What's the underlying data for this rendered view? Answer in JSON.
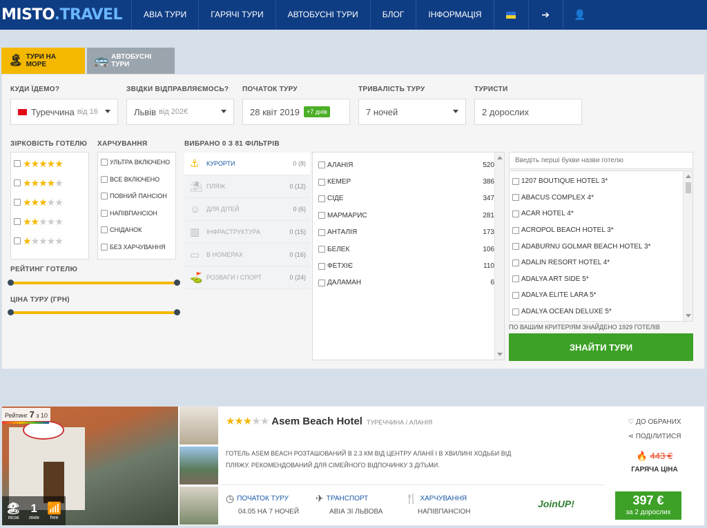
{
  "header": {
    "logo_main": "MISTO",
    "logo_dot": ".",
    "logo_travel": "TRAVEL",
    "nav": [
      "АВІА ТУРИ",
      "ГАРЯЧІ ТУРИ",
      "АВТОБУСНІ ТУРИ",
      "БЛОГ",
      "ІНФОРМАЦІЯ"
    ],
    "icons": [
      "ukraine-flag-icon",
      "login-icon",
      "register-user-icon"
    ]
  },
  "tabs": [
    {
      "label": "ТУРИ НА МОРЕ",
      "icon": "beach-icon",
      "active": true
    },
    {
      "label": "АВТОБУСНІ ТУРИ",
      "icon": "bus-icon",
      "active": false
    }
  ],
  "search": {
    "destination_label": "КУДИ ЇДЕМО?",
    "destination_value": "Туреччина",
    "destination_from": "від 16",
    "departure_label": "ЗВІДКИ ВІДПРАВЛЯЄМОСЬ?",
    "departure_value": "Львів",
    "departure_from": "від 202€",
    "start_label": "ПОЧАТОК ТУРУ",
    "start_value": "28 квіт 2019",
    "start_badge": "+7 днів",
    "duration_label": "ТРИВАЛІСТЬ ТУРУ",
    "duration_value": "7 ночей",
    "tourists_label": "ТУРИСТИ",
    "tourists_value": "2 дорослих"
  },
  "filters": {
    "stars_label": "ЗІРКОВІСТЬ ГОТЕЛЮ",
    "stars_levels": [
      5,
      4,
      3,
      2,
      1
    ],
    "food_label": "ХАРЧУВАННЯ",
    "food_items": [
      "УЛЬТРА ВКЛЮЧЕНО",
      "ВСЕ ВКЛЮЧЕНО",
      "ПОВНИЙ ПАНСІОН",
      "НАПІВПАНСІОН",
      "СНІДАНОК",
      "БЕЗ ХАРЧУВАННЯ"
    ],
    "rating_label": "РЕЙТИНГ ГОТЕЛЮ",
    "price_label": "ЦІНА ТУРУ (ГРН)",
    "selected_label": "ВИБРАНО 0 З 81 ФІЛЬТРІВ",
    "categories": [
      {
        "label": "КУРОРТИ",
        "count": "0 (8)",
        "icon": "anchor-icon"
      },
      {
        "label": "ПЛЯЖ",
        "count": "0 (12)",
        "icon": "beach-umbrella-icon"
      },
      {
        "label": "ДЛЯ ДІТЕЙ",
        "count": "0 (6)",
        "icon": "child-icon"
      },
      {
        "label": "ІНФРАСТРУКТУРА",
        "count": "0 (15)",
        "icon": "building-icon"
      },
      {
        "label": "В НОМЕРАХ",
        "count": "0 (16)",
        "icon": "room-icon"
      },
      {
        "label": "РОЗВАГИ І СПОРТ",
        "count": "0 (24)",
        "icon": "golf-icon"
      }
    ],
    "resorts": [
      {
        "name": "АЛАНІЯ",
        "count": "520"
      },
      {
        "name": "КЕМЕР",
        "count": "386"
      },
      {
        "name": "СІДЕ",
        "count": "347"
      },
      {
        "name": "МАРМАРИС",
        "count": "281"
      },
      {
        "name": "АНТАЛІЯ",
        "count": "173"
      },
      {
        "name": "БЕЛЕК",
        "count": "106"
      },
      {
        "name": "ФЕТХІЄ",
        "count": "110"
      },
      {
        "name": "ДАЛАМАН",
        "count": "6"
      }
    ],
    "hotel_search_placeholder": "Введіть перші букви назви готелю",
    "hotels": [
      "1207 BOUTIQUE HOTEL 3*",
      "ABACUS COMPLEX 4*",
      "ACAR HOTEL 4*",
      "ACROPOL BEACH HOTEL 3*",
      "ADABURNU GOLMAR BEACH HOTEL 3*",
      "ADALIN RESORT HOTEL 4*",
      "ADALYA ART SIDE 5*",
      "ADALYA ELITE LARA 5*",
      "ADALYA OCEAN DELUXE 5*"
    ],
    "found_text": "ПО ВАШИМ КРИТЕРІЯМ ЗНАЙДЕНО 1929 ГОТЕЛІВ",
    "search_button": "ЗНАЙТИ ТУРИ"
  },
  "result": {
    "rating_prefix": "Рейтинг",
    "rating_value": "7",
    "rating_suffix": "з 10",
    "photo_icons": [
      {
        "big": "",
        "small": "пісок",
        "icon": "sand-icon"
      },
      {
        "big": "1",
        "small": "лінія",
        "icon": ""
      },
      {
        "big": "",
        "small": "free",
        "icon": "wifi-icon"
      }
    ],
    "stars": 3,
    "hotel_name": "Asem Beach Hotel",
    "location": "ТУРЕЧЧИНА / АЛАНІЯ",
    "description": "ГОТЕЛЬ ASEM BEACH РОЗТАШОВАНИЙ В 2.3 КМ ВІД ЦЕНТРУ АЛАНІЇ І В ХВИЛИНІ ХОДЬБИ ВІД ПЛЯЖУ. РЕКОМЕНДОВАНИЙ ДЛЯ СІМЕЙНОГО ВІДПОЧИНКУ З ДІТЬМИ.",
    "start_title": "ПОЧАТОК ТУРУ",
    "start_value": "04.05 НА 7 НОЧЕЙ",
    "transport_title": "ТРАНСПОРТ",
    "transport_value": "АВІА ЗІ ЛЬВОВА",
    "food_title": "ХАРЧУВАННЯ",
    "food_value": "НАПІВПАНСІОН",
    "operator_logo": "JoinUP!",
    "favorites": "ДО ОБРАНИХ",
    "share": "ПОДІЛИТИСЯ",
    "old_price": "443 €",
    "hot_label": "ГАРЯЧА ЦІНА",
    "price": "397 €",
    "price_sub": "за 2 дорослих"
  },
  "colors": {
    "header_bg": "#0f3d84",
    "accent_yellow": "#f5b800",
    "accent_green": "#3ca126",
    "link_blue": "#1b5aa7",
    "hot_red": "#e84a2a"
  }
}
